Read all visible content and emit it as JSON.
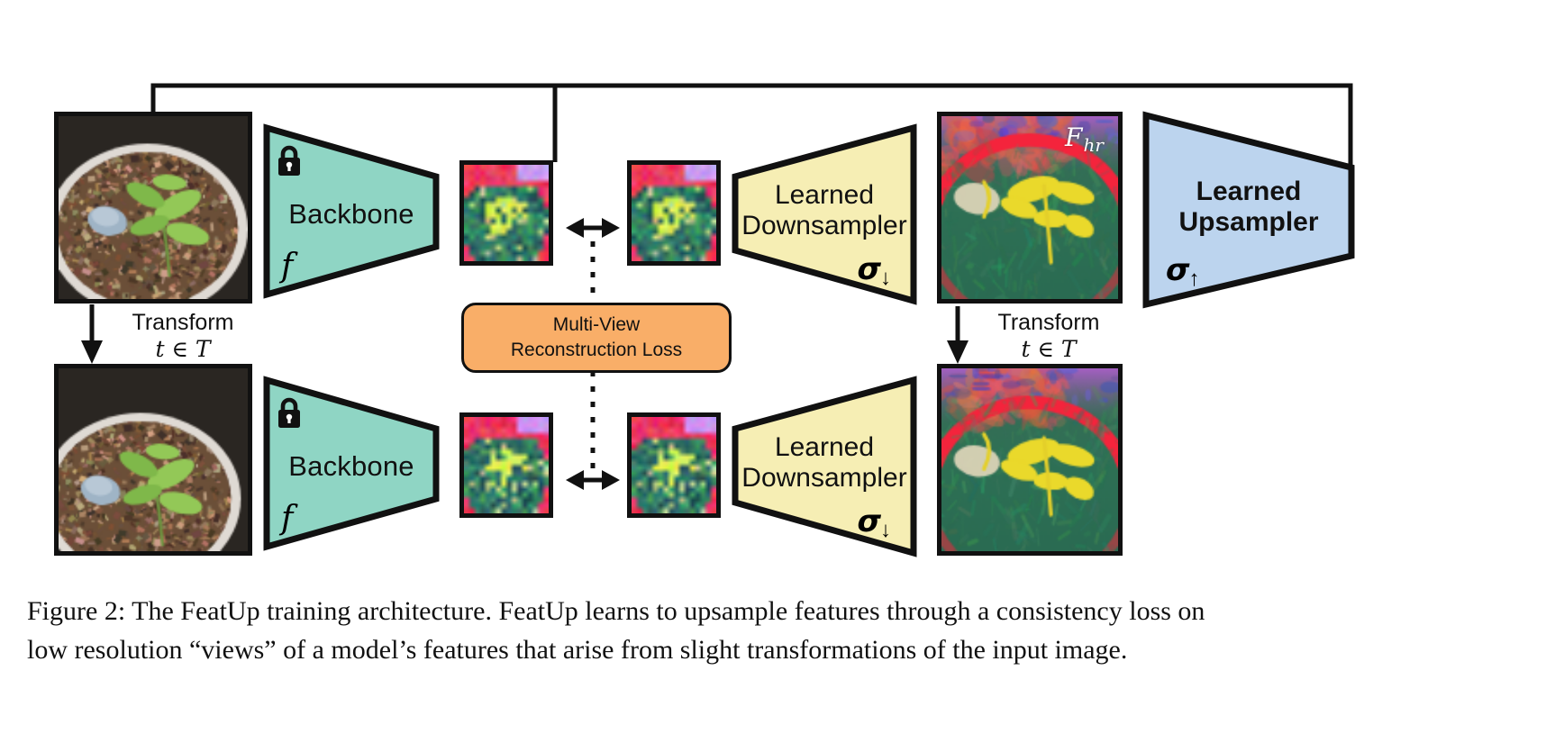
{
  "figure": {
    "number": "Figure 2:",
    "caption_line1": "Figure 2:  The FeatUp training architecture. FeatUp learns to upsample features through a consistency loss on",
    "caption_line2": "low resolution “views” of a model’s features that arise from slight transformations of the input image."
  },
  "colors": {
    "backbone_fill": "#8fd5c4",
    "downsampler_fill": "#f6eeb4",
    "upsampler_fill": "#bcd4ee",
    "loss_fill": "#f9ae68",
    "stroke": "#111111",
    "page_background": "#ffffff"
  },
  "blocks": {
    "backbone_top": {
      "label": "Backbone",
      "math": "f",
      "icon": "lock-icon",
      "fill": "#8fd5c4"
    },
    "backbone_bottom": {
      "label": "Backbone",
      "math": "f",
      "icon": "lock-icon",
      "fill": "#8fd5c4"
    },
    "downsampler_top": {
      "label_line1": "Learned",
      "label_line2": "Downsampler",
      "math": "σ",
      "math_sub": "↓",
      "fill": "#f6eeb4"
    },
    "downsampler_bottom": {
      "label_line1": "Learned",
      "label_line2": "Downsampler",
      "math": "σ",
      "math_sub": "↓",
      "fill": "#f6eeb4"
    },
    "upsampler": {
      "label_line1": "Learned",
      "label_line2": "Upsampler",
      "math": "σ",
      "math_sub": "↑",
      "fill": "#bcd4ee"
    },
    "loss": {
      "line1": "Multi-View",
      "line2": "Reconstruction Loss",
      "fill": "#f9ae68"
    }
  },
  "labels": {
    "transform_left": {
      "word": "Transform",
      "math": "t ∈ T"
    },
    "transform_right": {
      "word": "Transform",
      "math": "t ∈ T"
    },
    "hr_features": "F",
    "hr_features_sub": "hr"
  },
  "images": {
    "input_top": {
      "name": "input-photo-original",
      "alt": "seedling in bark-mulch pot"
    },
    "input_bottom": {
      "name": "input-photo-transformed",
      "alt": "seedling in bark-mulch pot, shifted view"
    },
    "feat_lr_top_left": {
      "name": "low-res-feature-map",
      "grid": 16
    },
    "feat_lr_top_right": {
      "name": "low-res-feature-map",
      "grid": 16
    },
    "feat_lr_bottom_left": {
      "name": "low-res-feature-map",
      "grid": 16
    },
    "feat_lr_bottom_right": {
      "name": "low-res-feature-map",
      "grid": 16
    },
    "feat_hr_top": {
      "name": "high-res-feature-map"
    },
    "feat_hr_bottom": {
      "name": "high-res-feature-map"
    }
  },
  "connectors": {
    "top_routing": "input image to learned upsampler",
    "drop_to_features": "routing line into upsampled features",
    "compare_top": "double-headed arrow",
    "compare_bottom": "double-headed arrow",
    "loss_dotted": "dotted line to multi-view reconstruction loss"
  }
}
